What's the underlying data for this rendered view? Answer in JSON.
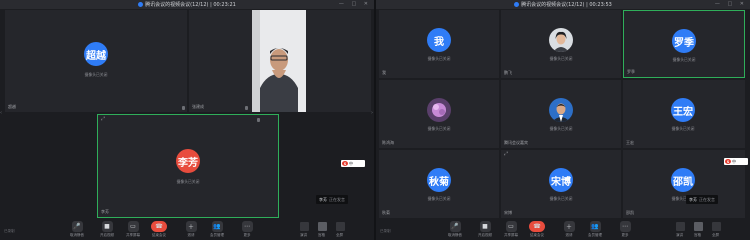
{
  "left": {
    "title": "腾讯会议的视频会议(12/12) | 00:23:21",
    "tiles": [
      {
        "avatar": "超越",
        "status": "摄像头已关闭",
        "name": "超越"
      },
      {
        "name": "张建成"
      },
      {
        "avatar": "李芳",
        "status": "摄像头已关闭",
        "name": "李芳"
      }
    ],
    "toast": {
      "name": "李芳",
      "text": "正在发言"
    }
  },
  "right": {
    "title": "腾讯会议的视频会议(12/12) | 00:23:53",
    "tiles": [
      {
        "avatar": "我",
        "status": "摄像头已关闭",
        "name": "我"
      },
      {
        "status": "摄像头已关闭",
        "name": "鹏飞"
      },
      {
        "avatar": "罗季",
        "status": "摄像头已关闭",
        "name": "罗季"
      },
      {
        "status": "摄像头已关闭",
        "name": "陈鸿海"
      },
      {
        "status": "摄像头已关闭",
        "name": "腾讯会议嘉宾"
      },
      {
        "avatar": "王宏",
        "status": "摄像头已关闭",
        "name": "王宏"
      },
      {
        "avatar": "秋菊",
        "status": "摄像头已关闭",
        "name": "秋菊"
      },
      {
        "avatar": "宋博",
        "status": "摄像头已关闭",
        "name": "宋博"
      },
      {
        "avatar": "邵凯",
        "status": "摄像头已关闭",
        "name": "邵凯"
      }
    ],
    "toast": {
      "name": "李芳",
      "text": "正在发言"
    }
  },
  "toolbar": {
    "items": [
      "取消静音",
      "开启视频",
      "共享屏幕",
      "结束会议",
      "邀请",
      "会员管理",
      "更多"
    ],
    "layouts": [
      "演讲",
      "宫格",
      "全屏"
    ],
    "corner": "已录制"
  },
  "ime": {
    "letter": "S",
    "label": "中"
  },
  "colors": {
    "accent": "#2f7cf6",
    "active_border": "#2fae5a",
    "hangup": "#e84c3d"
  }
}
